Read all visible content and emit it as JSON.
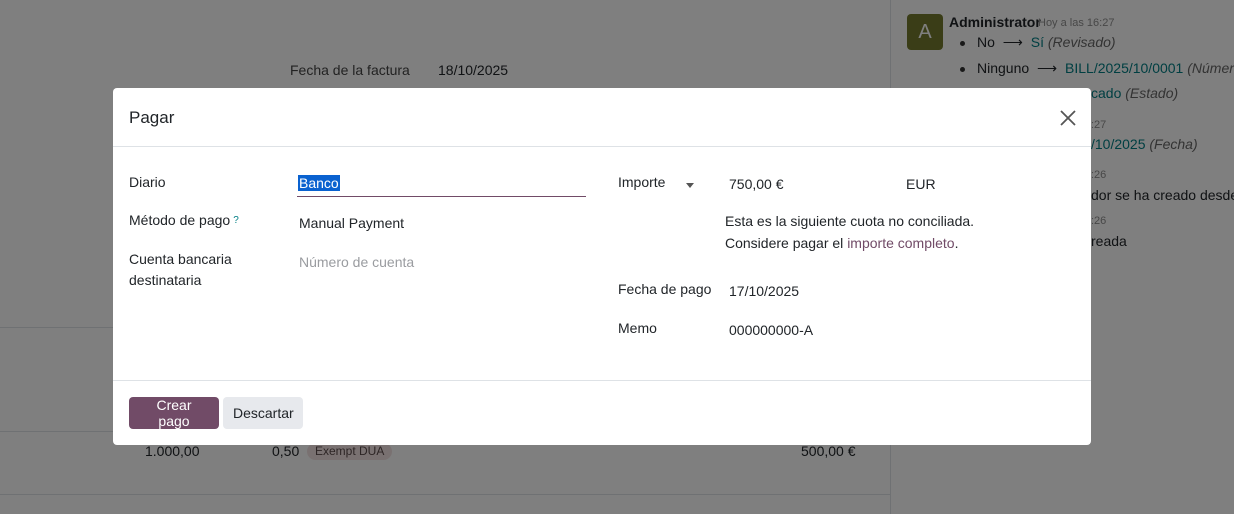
{
  "background": {
    "invoice_date_label": "Fecha de la factura",
    "invoice_date_value": "18/10/2025",
    "line": {
      "quantity": "1.000,00",
      "price": "0,50",
      "tax_tag": "Exempt DUA",
      "subtotal": "500,00 €"
    }
  },
  "chatter": {
    "avatar_letter": "A",
    "author": "Administrator",
    "time": "Hoy a las 16:27",
    "tracking": [
      {
        "old": "No",
        "new": "Sí",
        "field": "(Revisado)"
      },
      {
        "old": "Ninguno",
        "new": "BILL/2025/10/0001",
        "field": "(Número"
      }
    ],
    "partial_state_value": "cado",
    "partial_state_field": "(Estado)",
    "time_fragment_1": ":27",
    "partial_date_value": "/10/2025",
    "partial_date_field": "(Fecha)",
    "time_fragment_2": ":26",
    "partial_message_1": "dor se ha creado desde:",
    "time_fragment_3": ":26",
    "partial_message_2": "reada"
  },
  "dialog": {
    "title": "Pagar",
    "journal_label": "Diario",
    "journal_value": "Banco",
    "payment_method_label": "Método de pago",
    "payment_method_help": "?",
    "payment_method_value": "Manual Payment",
    "bank_account_label_1": "Cuenta bancaria",
    "bank_account_label_2": "destinataria",
    "bank_account_placeholder": "Número de cuenta",
    "amount_label": "Importe",
    "amount_value": "750,00 €",
    "currency_value": "EUR",
    "installment_note_1": "Esta es la siguiente cuota no conciliada.",
    "installment_note_2_prefix": "Considere pagar el ",
    "installment_note_2_link": "importe completo",
    "installment_note_2_suffix": ".",
    "payment_date_label": "Fecha de pago",
    "payment_date_value": "17/10/2025",
    "memo_label": "Memo",
    "memo_value": "000000000-A",
    "create_button": "Crear pago",
    "discard_button": "Descartar"
  },
  "colors": {
    "primary": "#714b67",
    "link": "#017e84",
    "avatar": "#757a2e"
  }
}
